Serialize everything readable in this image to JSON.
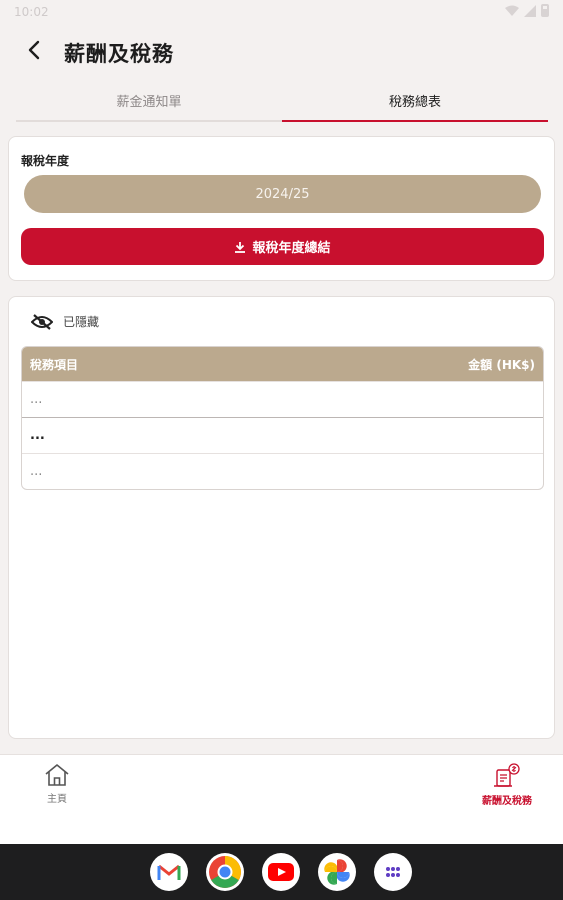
{
  "status_bar": {
    "time": "10:02"
  },
  "header": {
    "title": "薪酬及稅務"
  },
  "tabs": [
    {
      "label": "薪金通知單",
      "active": false
    },
    {
      "label": "稅務總表",
      "active": true
    }
  ],
  "year_card": {
    "label": "報稅年度",
    "selected_year": "2024/25",
    "summary_button": "報稅年度總結"
  },
  "tax_card": {
    "hide_label": "已隱藏",
    "columns": {
      "item": "稅務項目",
      "amount": "金額 (HK$)"
    },
    "rows": [
      "...",
      "...",
      "..."
    ]
  },
  "bottom_nav": [
    {
      "label": "主頁",
      "icon": "home-icon",
      "active": false
    },
    {
      "label": "薪酬及稅務",
      "icon": "salary-tax-icon",
      "active": true
    }
  ],
  "dock": [
    "gmail-icon",
    "chrome-icon",
    "youtube-icon",
    "photos-icon",
    "app-drawer-icon"
  ],
  "colors": {
    "brand_red": "#c8102e",
    "tan": "#bba98e",
    "background": "#f4f1f0"
  }
}
